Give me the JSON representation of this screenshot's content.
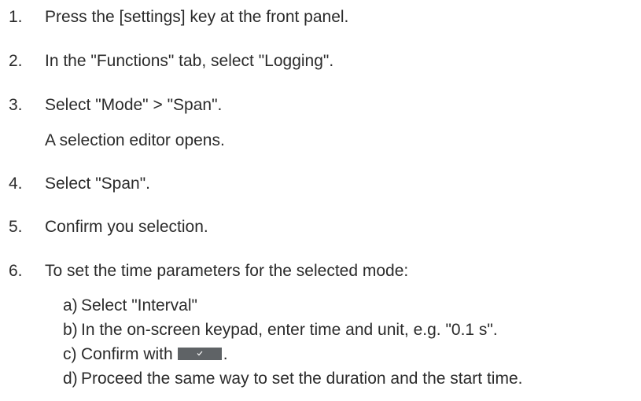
{
  "steps": [
    {
      "num": "1.",
      "text": "Press the [settings] key at the front panel."
    },
    {
      "num": "2.",
      "text": "In the \"Functions\" tab, select \"Logging\"."
    },
    {
      "num": "3.",
      "text": "Select \"Mode\" > \"Span\".",
      "note": "A selection editor opens."
    },
    {
      "num": "4.",
      "text": "Select \"Span\"."
    },
    {
      "num": "5.",
      "text": "Confirm you selection."
    },
    {
      "num": "6.",
      "text": "To set the time parameters for the selected mode:"
    }
  ],
  "substeps": [
    {
      "label": "a)",
      "text": "Select \"Interval\""
    },
    {
      "label": "b)",
      "text": "In the on-screen keypad, enter time and unit, e.g. \"0.1 s\"."
    },
    {
      "label": "c)",
      "text": "Confirm with",
      "after": ".",
      "icon": "checkmark-icon",
      "key_color": "#5f6366"
    },
    {
      "label": "d)",
      "text": "Proceed the same way to set the duration and the start time."
    }
  ]
}
